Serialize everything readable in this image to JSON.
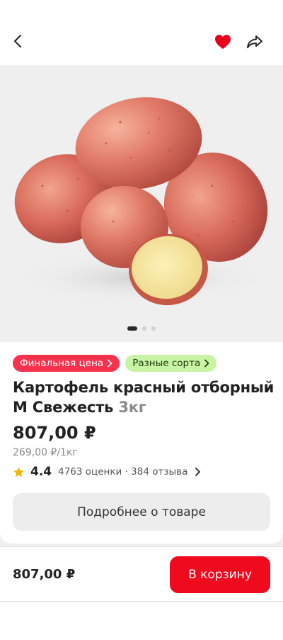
{
  "header": {
    "back_icon": "chevron-left-icon",
    "favorite_icon": "heart-filled-icon",
    "share_icon": "share-arrow-icon",
    "favorite_color": "#e8001c"
  },
  "gallery": {
    "image_subject": "red potatoes",
    "dots_total": 3,
    "active_index": 0
  },
  "badges": [
    {
      "label": "Финальная цена",
      "bg": "#f7324d"
    },
    {
      "label": "Разные сорта",
      "bg": "#c9f3a5"
    }
  ],
  "product": {
    "title": "Картофель красный отборный М Свежесть",
    "weight": "3кг",
    "price": "807,00 ₽",
    "unit_price": "269,00 ₽/1кг",
    "rating": "4.4",
    "rating_meta": "4763 оценки · 384 отзыва"
  },
  "details_button": "Подробнее о товаре",
  "bottom_bar": {
    "price": "807,00 ₽",
    "cart_button": "В корзину",
    "accent": "#f00a1e"
  }
}
